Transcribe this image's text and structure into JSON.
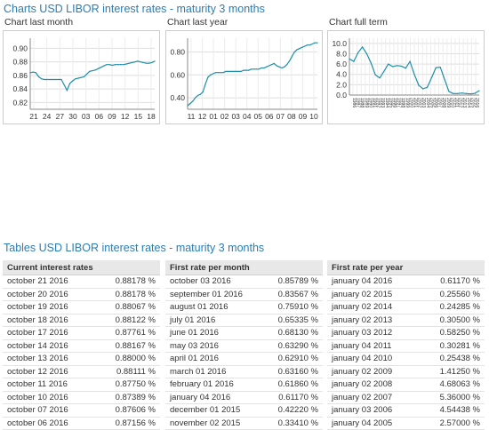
{
  "charts_title": "Charts USD LIBOR interest rates - maturity 3 months",
  "tables_title": "Tables USD LIBOR interest rates - maturity 3 months",
  "chart_data": [
    {
      "type": "line",
      "title": "Chart last month",
      "x_labels": [
        "21",
        "24",
        "27",
        "30",
        "03",
        "06",
        "09",
        "12",
        "15",
        "18"
      ],
      "y_ticks": [
        0.82,
        0.84,
        0.86,
        0.88,
        0.9
      ],
      "ylim": [
        0.81,
        0.915
      ],
      "color": "#1e8fa8",
      "grid": true,
      "values": [
        0.864,
        0.865,
        0.864,
        0.858,
        0.855,
        0.854,
        0.854,
        0.854,
        0.854,
        0.854,
        0.854,
        0.854,
        0.846,
        0.838,
        0.848,
        0.852,
        0.855,
        0.856,
        0.857,
        0.858,
        0.862,
        0.866,
        0.867,
        0.868,
        0.87,
        0.872,
        0.874,
        0.876,
        0.876,
        0.875,
        0.876,
        0.876,
        0.876,
        0.876,
        0.877,
        0.878,
        0.879,
        0.88,
        0.881,
        0.88,
        0.879,
        0.878,
        0.878,
        0.879,
        0.881
      ]
    },
    {
      "type": "line",
      "title": "Chart last year",
      "x_labels": [
        "11",
        "12",
        "01",
        "02",
        "03",
        "04",
        "05",
        "06",
        "07",
        "08",
        "09",
        "10"
      ],
      "y_ticks": [
        0.4,
        0.6,
        0.8
      ],
      "ylim": [
        0.3,
        0.92
      ],
      "color": "#1e8fa8",
      "grid": true,
      "values": [
        0.33,
        0.35,
        0.37,
        0.4,
        0.42,
        0.43,
        0.45,
        0.52,
        0.58,
        0.6,
        0.61,
        0.62,
        0.62,
        0.62,
        0.62,
        0.63,
        0.63,
        0.63,
        0.63,
        0.63,
        0.63,
        0.63,
        0.64,
        0.64,
        0.64,
        0.65,
        0.65,
        0.65,
        0.65,
        0.66,
        0.66,
        0.67,
        0.68,
        0.69,
        0.7,
        0.68,
        0.67,
        0.66,
        0.67,
        0.69,
        0.72,
        0.76,
        0.8,
        0.82,
        0.83,
        0.84,
        0.85,
        0.86,
        0.86,
        0.87,
        0.88,
        0.88
      ]
    },
    {
      "type": "line",
      "title": "Chart full term",
      "x_labels": [
        "1986",
        "1987",
        "1988",
        "1989",
        "1990",
        "1991",
        "1992",
        "1993",
        "1994",
        "1995",
        "1996",
        "1997",
        "1998",
        "1999",
        "2000",
        "2001",
        "2002",
        "2003",
        "2004",
        "2005",
        "2006",
        "2007",
        "2008",
        "2009",
        "2010",
        "2011",
        "2012",
        "2013",
        "2014",
        "2015",
        "2016"
      ],
      "y_ticks": [
        0.0,
        2.0,
        4.0,
        6.0,
        8.0,
        10.0
      ],
      "ylim": [
        0,
        11
      ],
      "color": "#1e8fa8",
      "grid": true,
      "values": [
        7.0,
        6.5,
        8.2,
        9.3,
        8.0,
        6.2,
        3.9,
        3.3,
        4.6,
        6.0,
        5.5,
        5.7,
        5.6,
        5.2,
        6.5,
        4.0,
        1.9,
        1.2,
        1.5,
        3.4,
        5.3,
        5.4,
        3.0,
        0.7,
        0.3,
        0.3,
        0.4,
        0.3,
        0.23,
        0.32,
        0.85
      ]
    }
  ],
  "tables": [
    {
      "header": "Current interest rates",
      "rows": [
        [
          "october 21 2016",
          "0.88178 %"
        ],
        [
          "october 20 2016",
          "0.88178 %"
        ],
        [
          "october 19 2016",
          "0.88067 %"
        ],
        [
          "october 18 2016",
          "0.88122 %"
        ],
        [
          "october 17 2016",
          "0.87761 %"
        ],
        [
          "october 14 2016",
          "0.88167 %"
        ],
        [
          "october 13 2016",
          "0.88000 %"
        ],
        [
          "october 12 2016",
          "0.88111 %"
        ],
        [
          "october 11 2016",
          "0.87750 %"
        ],
        [
          "october 10 2016",
          "0.87389 %"
        ],
        [
          "october 07 2016",
          "0.87606 %"
        ],
        [
          "october 06 2016",
          "0.87156 %"
        ]
      ]
    },
    {
      "header": "First rate per month",
      "rows": [
        [
          "october 03 2016",
          "0.85789 %"
        ],
        [
          "september 01 2016",
          "0.83567 %"
        ],
        [
          "august 01 2016",
          "0.75910 %"
        ],
        [
          "july 01 2016",
          "0.65335 %"
        ],
        [
          "june 01 2016",
          "0.68130 %"
        ],
        [
          "may 03 2016",
          "0.63290 %"
        ],
        [
          "april 01 2016",
          "0.62910 %"
        ],
        [
          "march 01 2016",
          "0.63160 %"
        ],
        [
          "february 01 2016",
          "0.61860 %"
        ],
        [
          "january 04 2016",
          "0.61170 %"
        ],
        [
          "december 01 2015",
          "0.42220 %"
        ],
        [
          "november 02 2015",
          "0.33410 %"
        ]
      ]
    },
    {
      "header": "First rate per year",
      "rows": [
        [
          "january 04 2016",
          "0.61170 %"
        ],
        [
          "january 02 2015",
          "0.25560 %"
        ],
        [
          "january 02 2014",
          "0.24285 %"
        ],
        [
          "january 02 2013",
          "0.30500 %"
        ],
        [
          "january 03 2012",
          "0.58250 %"
        ],
        [
          "january 04 2011",
          "0.30281 %"
        ],
        [
          "january 04 2010",
          "0.25438 %"
        ],
        [
          "january 02 2009",
          "1.41250 %"
        ],
        [
          "january 02 2008",
          "4.68063 %"
        ],
        [
          "january 02 2007",
          "5.36000 %"
        ],
        [
          "january 03 2006",
          "4.54438 %"
        ],
        [
          "january 04 2005",
          "2.57000 %"
        ]
      ]
    }
  ]
}
